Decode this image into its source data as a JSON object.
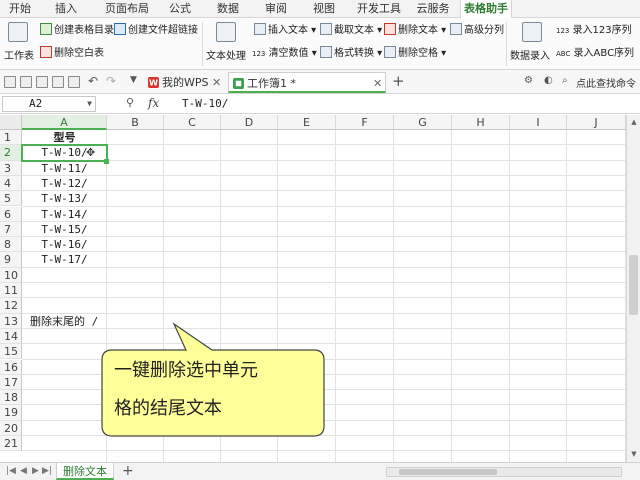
{
  "menu": {
    "items": [
      "开始",
      "插入",
      "页面布局",
      "公式",
      "数据",
      "审阅",
      "视图",
      "开发工具",
      "云服务",
      "表格助手"
    ],
    "active": "表格助手"
  },
  "ribbon": {
    "worksheet_label": "工作表",
    "create_table_index": "创建表格目录",
    "create_file_link": "创建文件超链接",
    "delete_empty_sheets": "删除空白表",
    "text_processing": "文本处理",
    "insert_text": "插入文本",
    "extract_text": "截取文本",
    "delete_text": "删除文本",
    "advanced_split": "高级分列",
    "clear_values": "清空数值",
    "format_convert": "格式转换",
    "delete_spaces": "删除空格",
    "data_entry": "数据录入",
    "entry_123": "录入123序列",
    "entry_abc": "录入ABC序列",
    "num_badge": "123",
    "abc_badge": "ABC"
  },
  "tabs": {
    "wps_tab": "我的WPS",
    "workbook_tab": "工作簿1 *",
    "search_cmd": "点此查找命令"
  },
  "formula_bar": {
    "cell_ref": "A2",
    "fx": "fx",
    "content": "T-W-10/"
  },
  "grid": {
    "columns": [
      "A",
      "B",
      "C",
      "D",
      "E",
      "F",
      "G",
      "H",
      "I",
      "J"
    ],
    "rows": [
      "1",
      "2",
      "3",
      "4",
      "5",
      "6",
      "7",
      "8",
      "9",
      "10",
      "11",
      "12",
      "13",
      "14",
      "15",
      "16",
      "17",
      "18",
      "19",
      "20",
      "21"
    ],
    "cells": {
      "a1": "型号",
      "a2": "T-W-10/",
      "a3": "T-W-11/",
      "a4": "T-W-12/",
      "a5": "T-W-13/",
      "a6": "T-W-14/",
      "a7": "T-W-15/",
      "a8": "T-W-16/",
      "a9": "T-W-17/",
      "a13": "删除末尾的 /"
    },
    "selected_cell": "A2"
  },
  "callout": {
    "line1": "一键删除选中单元",
    "line2": "格的结尾文本",
    "fill": "#ffff99",
    "stroke": "#444444"
  },
  "sheet_bar": {
    "sheet_name": "删除文本",
    "add": "+"
  },
  "colors": {
    "accent": "#4caf50",
    "active_menu": "#2e7d32"
  }
}
